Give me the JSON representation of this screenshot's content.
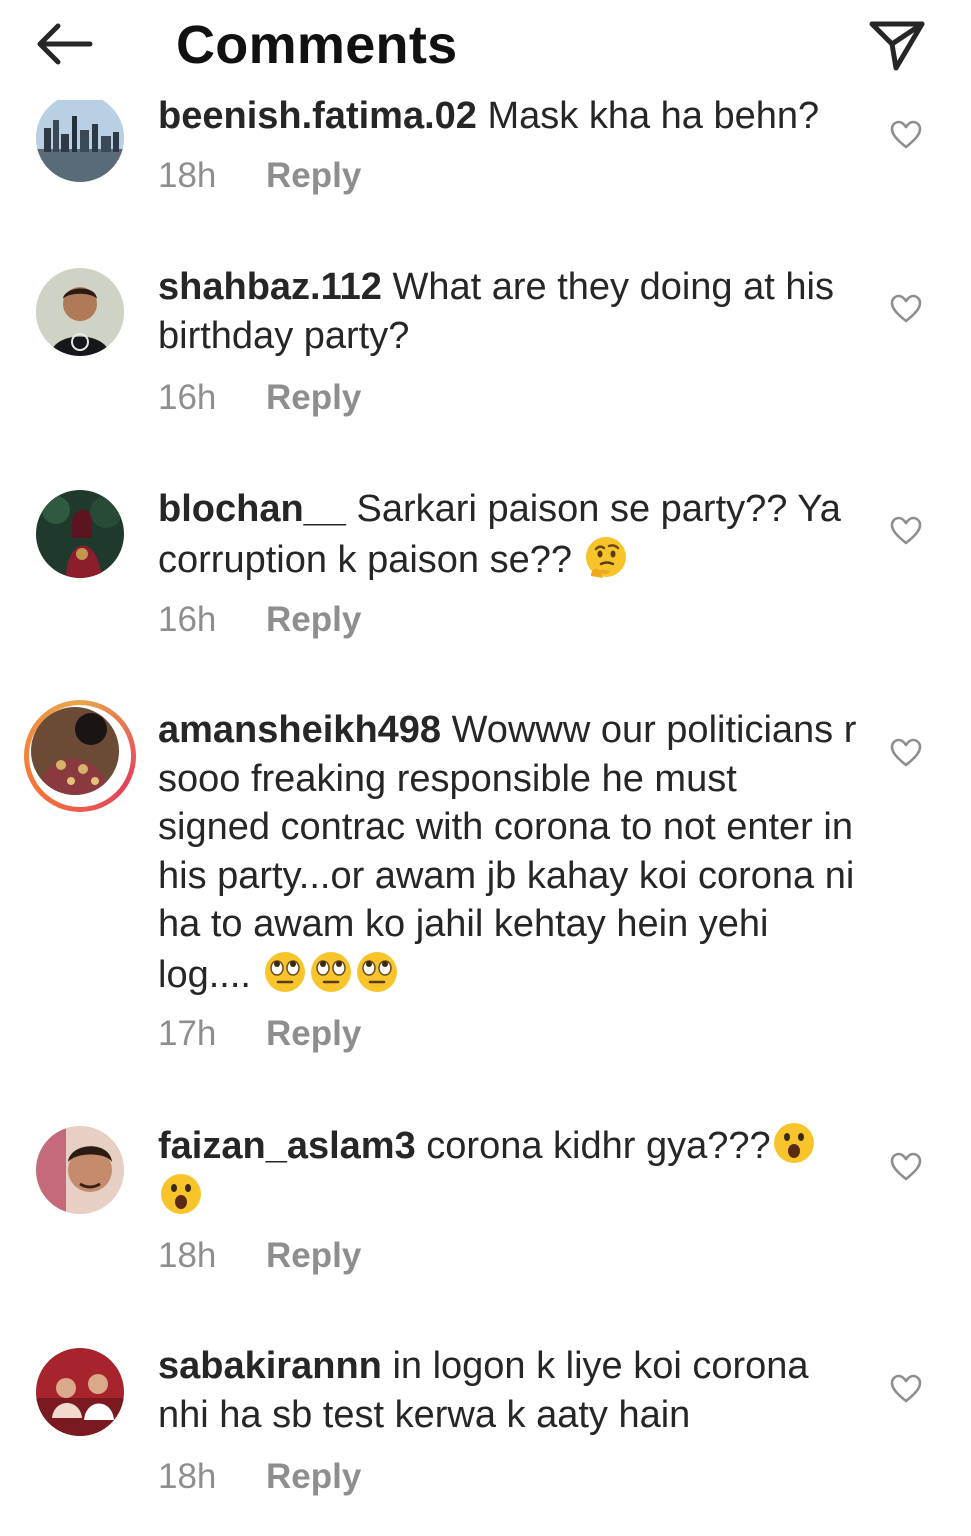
{
  "header": {
    "title": "Comments"
  },
  "colors": {
    "text": "#262626",
    "muted": "#8e8e8e",
    "emoji": "#f7c52b"
  },
  "comments": [
    {
      "username": "beenish.fatima.02",
      "text": "Mask kha ha behn?",
      "time": "18h",
      "reply": "Reply"
    },
    {
      "username": "shahbaz.112",
      "text": "What are they doing at his birthday party?",
      "time": "16h",
      "reply": "Reply"
    },
    {
      "username": "blochan__",
      "text": "Sarkari paison se party?? Ya corruption k paison se??",
      "emoji": "thinking-face",
      "time": "16h",
      "reply": "Reply"
    },
    {
      "username": "amansheikh498",
      "text": "Wowww our politicians r sooo freaking responsible he must signed contrac with corona to not enter in his party...or awam jb kahay koi corona ni ha to awam ko jahil kehtay hein yehi log....",
      "emoji": "face-with-rolling-eyes x3",
      "time": "17h",
      "reply": "Reply"
    },
    {
      "username": "faizan_aslam3",
      "text": "corona kidhr gya???",
      "emoji": "face-with-open-mouth x2",
      "time": "18h",
      "reply": "Reply"
    },
    {
      "username": "sabakirannn",
      "text": "in logon k liye koi corona nhi ha sb test kerwa k aaty hain",
      "time": "18h",
      "reply": "Reply"
    }
  ]
}
